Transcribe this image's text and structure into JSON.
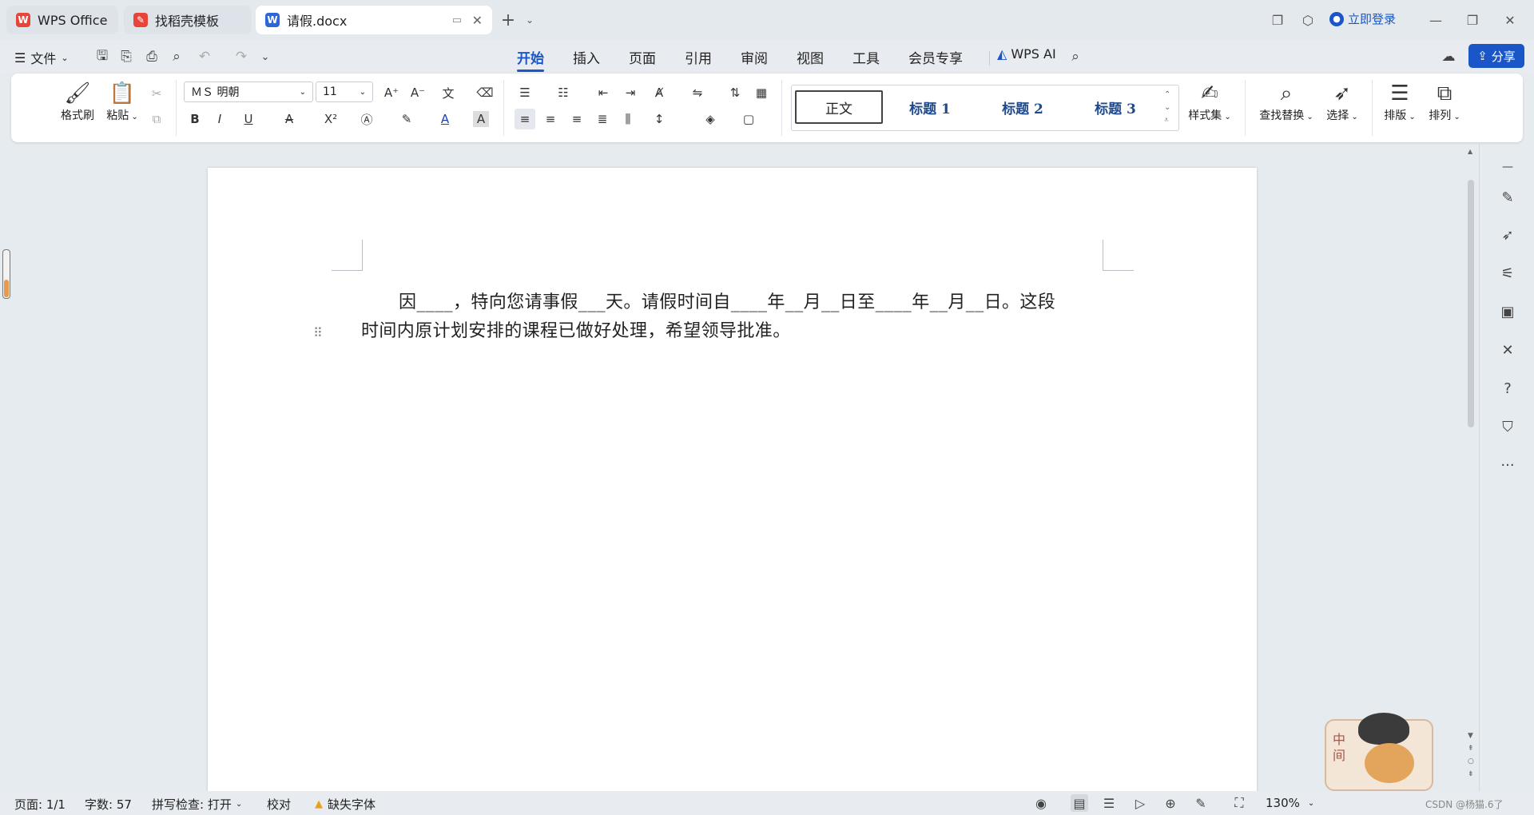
{
  "tabs": [
    {
      "label": "WPS Office"
    },
    {
      "label": "找稻壳模板"
    },
    {
      "label": "请假.docx"
    }
  ],
  "titlebar": {
    "login_label": "立即登录"
  },
  "menu": {
    "file_label": "文件",
    "tabs": [
      "开始",
      "插入",
      "页面",
      "引用",
      "审阅",
      "视图",
      "工具",
      "会员专享"
    ],
    "active_tab": "开始",
    "ai_label": "WPS AI",
    "share_label": "分享"
  },
  "ribbon": {
    "format_painter": "格式刷",
    "paste": "粘贴",
    "font_name": "ＭＳ 明朝",
    "font_size": "11",
    "styles": [
      "正文",
      "标题 1",
      "标题 2",
      "标题 3"
    ],
    "style_set": "样式集",
    "find_replace": "查找替换",
    "select": "选择",
    "layout": "排版",
    "arrange": "排列"
  },
  "document": {
    "line1": "因____，特向您请事假___天。请假时间自____年__月__日至____年__月__日。这段",
    "line2": "时间内原计划安排的课程已做好处理，希望领导批准。"
  },
  "status": {
    "page": "页面: 1/1",
    "words": "字数: 57",
    "spell": "拼写检查: 打开",
    "proof": "校对",
    "missing_font": "缺失字体",
    "zoom": "130%",
    "watermark": "CSDN @杨猫.6了"
  },
  "colors": {
    "accent": "#1a56c8",
    "wps_red": "#e8443a",
    "word_blue": "#2b67d9"
  }
}
